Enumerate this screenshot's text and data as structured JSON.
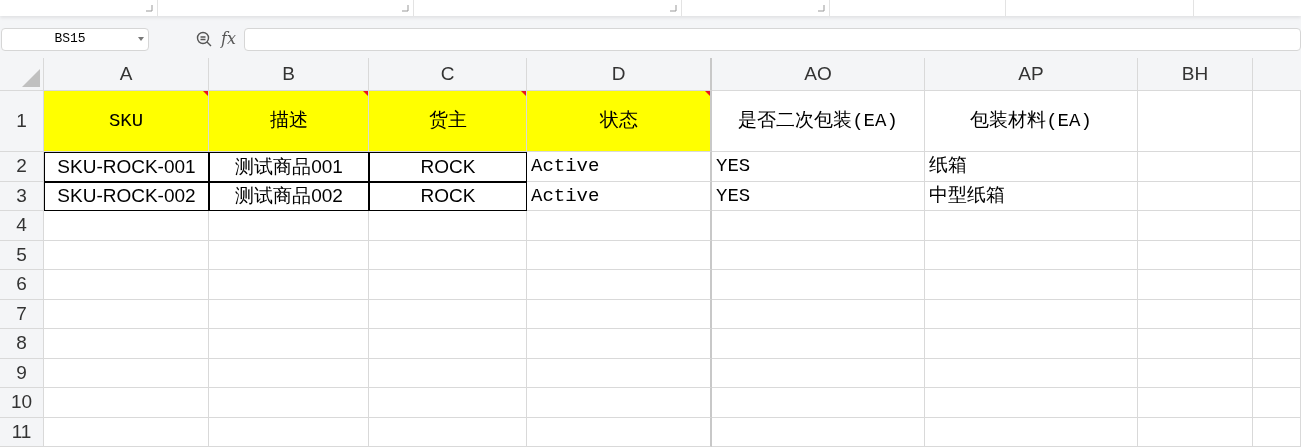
{
  "name_box": {
    "value": "BS15"
  },
  "formula_bar": {
    "fx": "fx"
  },
  "columns": [
    {
      "label": "A",
      "selected": false
    },
    {
      "label": "B",
      "selected": false
    },
    {
      "label": "C",
      "selected": false
    },
    {
      "label": "D",
      "selected": false
    },
    {
      "label": "AO",
      "selected": false
    },
    {
      "label": "AP",
      "selected": false
    },
    {
      "label": "BH",
      "selected": false
    }
  ],
  "rows": [
    {
      "label": "1",
      "cells": [
        {
          "text": "SKU",
          "kind": "highlight",
          "comment": true
        },
        {
          "text": "描述",
          "kind": "highlight",
          "comment": true
        },
        {
          "text": "货主",
          "kind": "highlight",
          "comment": true
        },
        {
          "text": "状态",
          "kind": "highlight",
          "comment": true
        },
        {
          "text": "是否二次包装(EA)",
          "kind": "header",
          "comment": false
        },
        {
          "text": "包装材料(EA)",
          "kind": "header",
          "comment": false
        },
        null
      ]
    },
    {
      "label": "2",
      "cells": [
        {
          "text": "SKU-ROCK-001",
          "kind": "boxed",
          "comment": false
        },
        {
          "text": "测试商品001",
          "kind": "boxed",
          "comment": false
        },
        {
          "text": "ROCK",
          "kind": "boxed",
          "comment": false
        },
        {
          "text": "Active",
          "kind": "text",
          "comment": false
        },
        {
          "text": "YES",
          "kind": "text",
          "comment": false
        },
        {
          "text": "纸箱",
          "kind": "text",
          "comment": false
        },
        null
      ]
    },
    {
      "label": "3",
      "cells": [
        {
          "text": "SKU-ROCK-002",
          "kind": "boxed",
          "comment": false
        },
        {
          "text": "测试商品002",
          "kind": "boxed",
          "comment": false
        },
        {
          "text": "ROCK",
          "kind": "boxed",
          "comment": false
        },
        {
          "text": "Active",
          "kind": "text",
          "comment": false
        },
        {
          "text": "YES",
          "kind": "text",
          "comment": false
        },
        {
          "text": "中型纸箱",
          "kind": "text",
          "comment": false
        },
        null
      ]
    },
    {
      "label": "4",
      "cells": []
    },
    {
      "label": "5",
      "cells": []
    },
    {
      "label": "6",
      "cells": []
    },
    {
      "label": "7",
      "cells": []
    },
    {
      "label": "8",
      "cells": []
    },
    {
      "label": "9",
      "cells": []
    },
    {
      "label": "10",
      "cells": []
    },
    {
      "label": "11",
      "cells": []
    }
  ]
}
